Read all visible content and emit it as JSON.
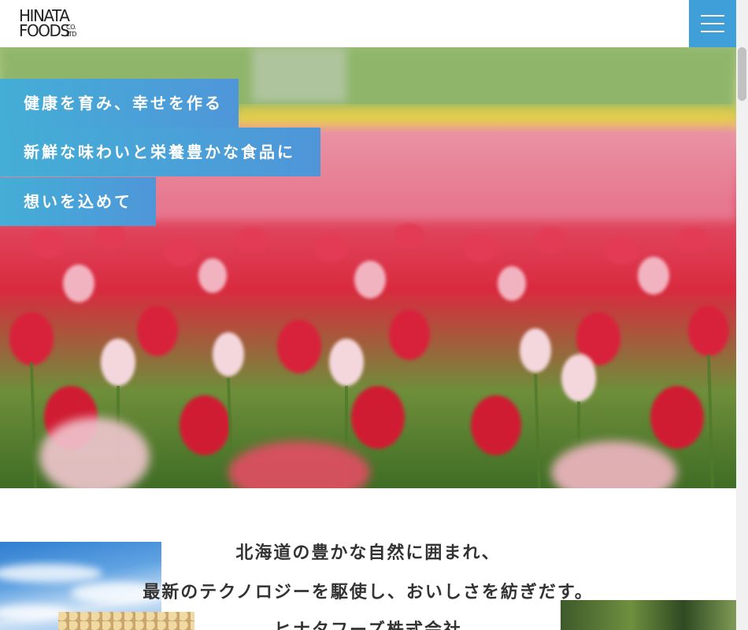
{
  "header": {
    "logo_line1": "HINATA",
    "logo_line2": "FOODS",
    "logo_co1": "CO.",
    "logo_co2": "LTD",
    "menu_icon": "hamburger-icon"
  },
  "colors": {
    "accent": "#3f9fd8",
    "catch_start": "#44aed6",
    "catch_end": "#4f96d9"
  },
  "hero": {
    "catch1": "健康を育み、幸せを作る",
    "catch2": "新鮮な味わいと栄養豊かな食品に",
    "catch3": "想いを込めて"
  },
  "intro": {
    "line1": "北海道の豊かな自然に囲まれ、",
    "line2": "最新のテクノロジーを駆使し、おいしさを紡ぎだす。",
    "line3": "ヒナタフーズ株式会社"
  }
}
